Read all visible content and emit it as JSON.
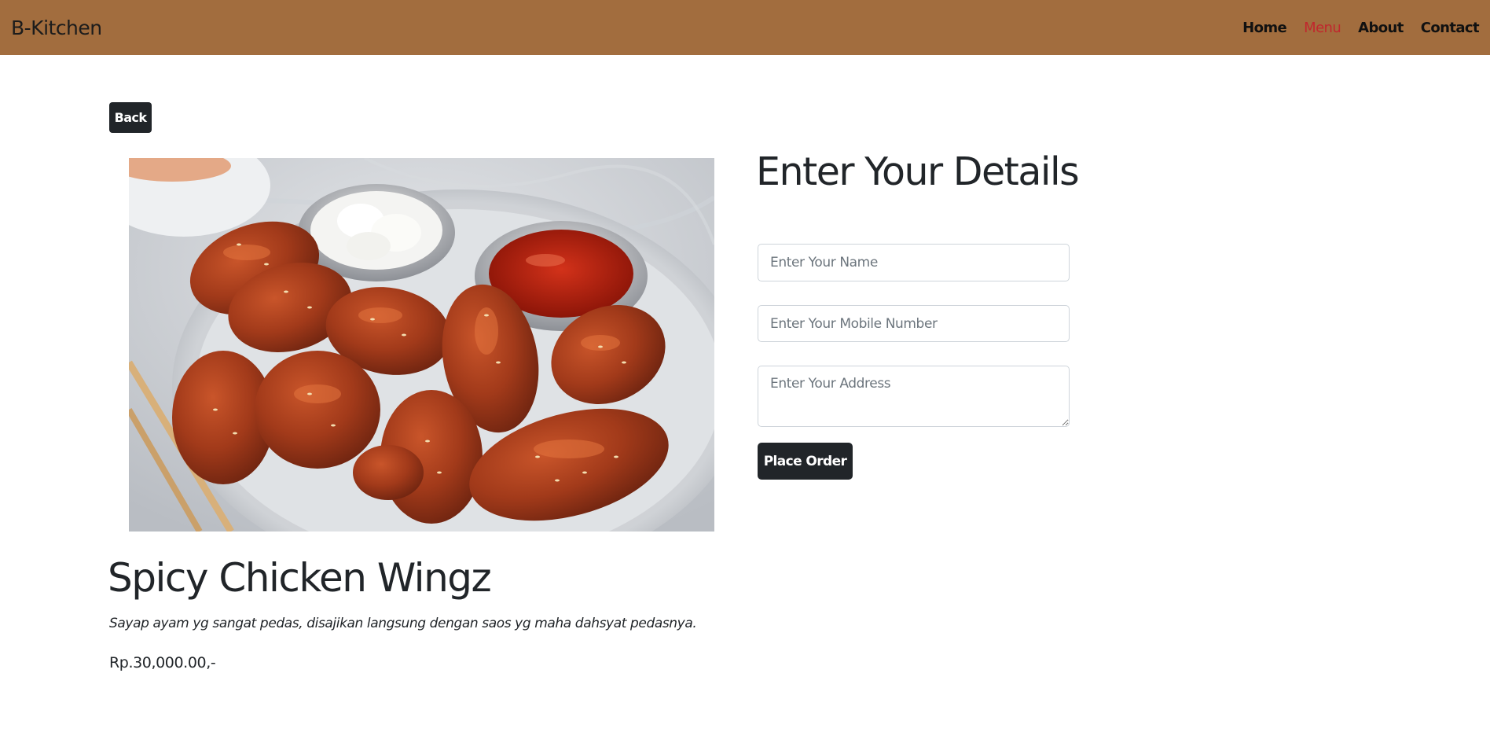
{
  "navbar": {
    "brand": "B-Kitchen",
    "links": [
      {
        "label": "Home",
        "active": false
      },
      {
        "label": "Menu",
        "active": true
      },
      {
        "label": "About",
        "active": false
      },
      {
        "label": "Contact",
        "active": false
      }
    ],
    "background_color": "#a26d3e",
    "active_color": "#c1272d"
  },
  "back_button": {
    "label": "Back"
  },
  "product": {
    "image_alt": "Spicy chicken wings with sesame seeds and dipping sauces on a plate",
    "title": "Spicy Chicken Wingz",
    "description": "Sayap ayam yg sangat pedas, disajikan langsung dengan saos yg maha dahsyat pedasnya.",
    "price": "Rp.30,000.00,-"
  },
  "order_form": {
    "title": "Enter Your Details",
    "name_placeholder": "Enter Your Name",
    "mobile_placeholder": "Enter Your Mobile Number",
    "address_placeholder": "Enter Your Address",
    "submit_label": "Place Order"
  },
  "icons": {
    "food_photo": "chicken-wings-photo"
  }
}
